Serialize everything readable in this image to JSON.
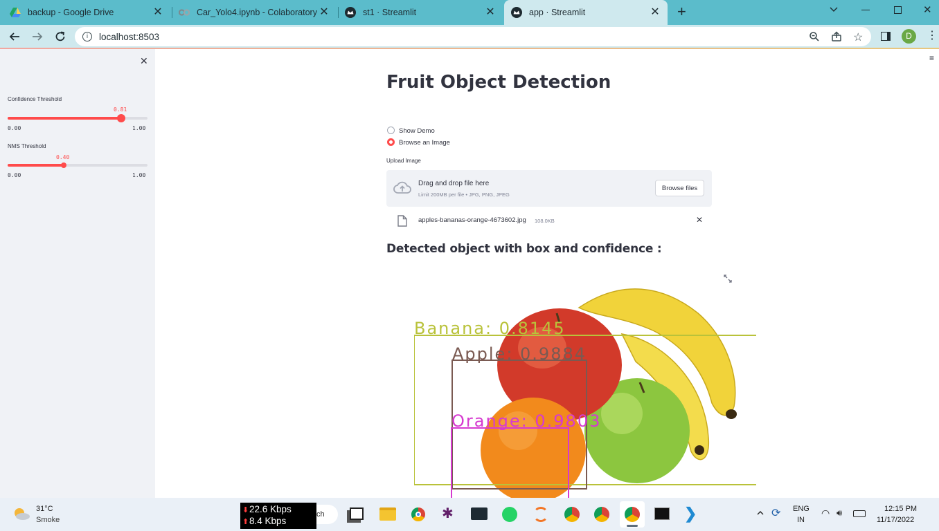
{
  "browser": {
    "tabs": [
      {
        "title": "backup - Google Drive"
      },
      {
        "title": "Car_Yolo4.ipynb - Colaboratory"
      },
      {
        "title": "st1 · Streamlit"
      },
      {
        "title": "app · Streamlit"
      }
    ],
    "url": "localhost:8503",
    "profile_initial": "D"
  },
  "sidebar": {
    "sliders": [
      {
        "label": "Confidence Threshold",
        "value": 0.81,
        "value_text": "0.81",
        "min_text": "0.00",
        "max_text": "1.00"
      },
      {
        "label": "NMS Threshold",
        "value": 0.4,
        "value_text": "0.40",
        "min_text": "0.00",
        "max_text": "1.00"
      }
    ]
  },
  "main": {
    "title": "Fruit Object Detection",
    "radio_options": [
      "Show Demo",
      "Browse an Image"
    ],
    "selected_option": "Browse an Image",
    "upload_label": "Upload Image",
    "dropzone_text": "Drag and drop file here",
    "dropzone_limit": "Limit 200MB per file • JPG, PNG, JPEG",
    "browse_button": "Browse files",
    "file_name": "apples-bananas-orange-4673602.jpg",
    "file_size": "108.0KB",
    "detected_heading": "Detected object with box and confidence :",
    "detections": [
      {
        "label": "Banana: 0.8145",
        "color": "#b9c23a"
      },
      {
        "label": "Apple: 0.9884",
        "color": "#7a5a52"
      },
      {
        "label": "Orange: 0.9803",
        "color": "#d63ad0"
      }
    ]
  },
  "colors": {
    "accent": "#ff4b4b",
    "tabstrip": "#5bbccb",
    "toolbar": "#cfe9ee",
    "sidebar_bg": "#f0f2f6"
  },
  "taskbar": {
    "weather_temp": "31°C",
    "weather_desc": "Smoke",
    "net_down": "22.6 Kbps",
    "net_up": "8.4 Kbps",
    "search_fragment": "ch",
    "lang_top": "ENG",
    "lang_bottom": "IN",
    "time": "12:15 PM",
    "date": "11/17/2022"
  }
}
